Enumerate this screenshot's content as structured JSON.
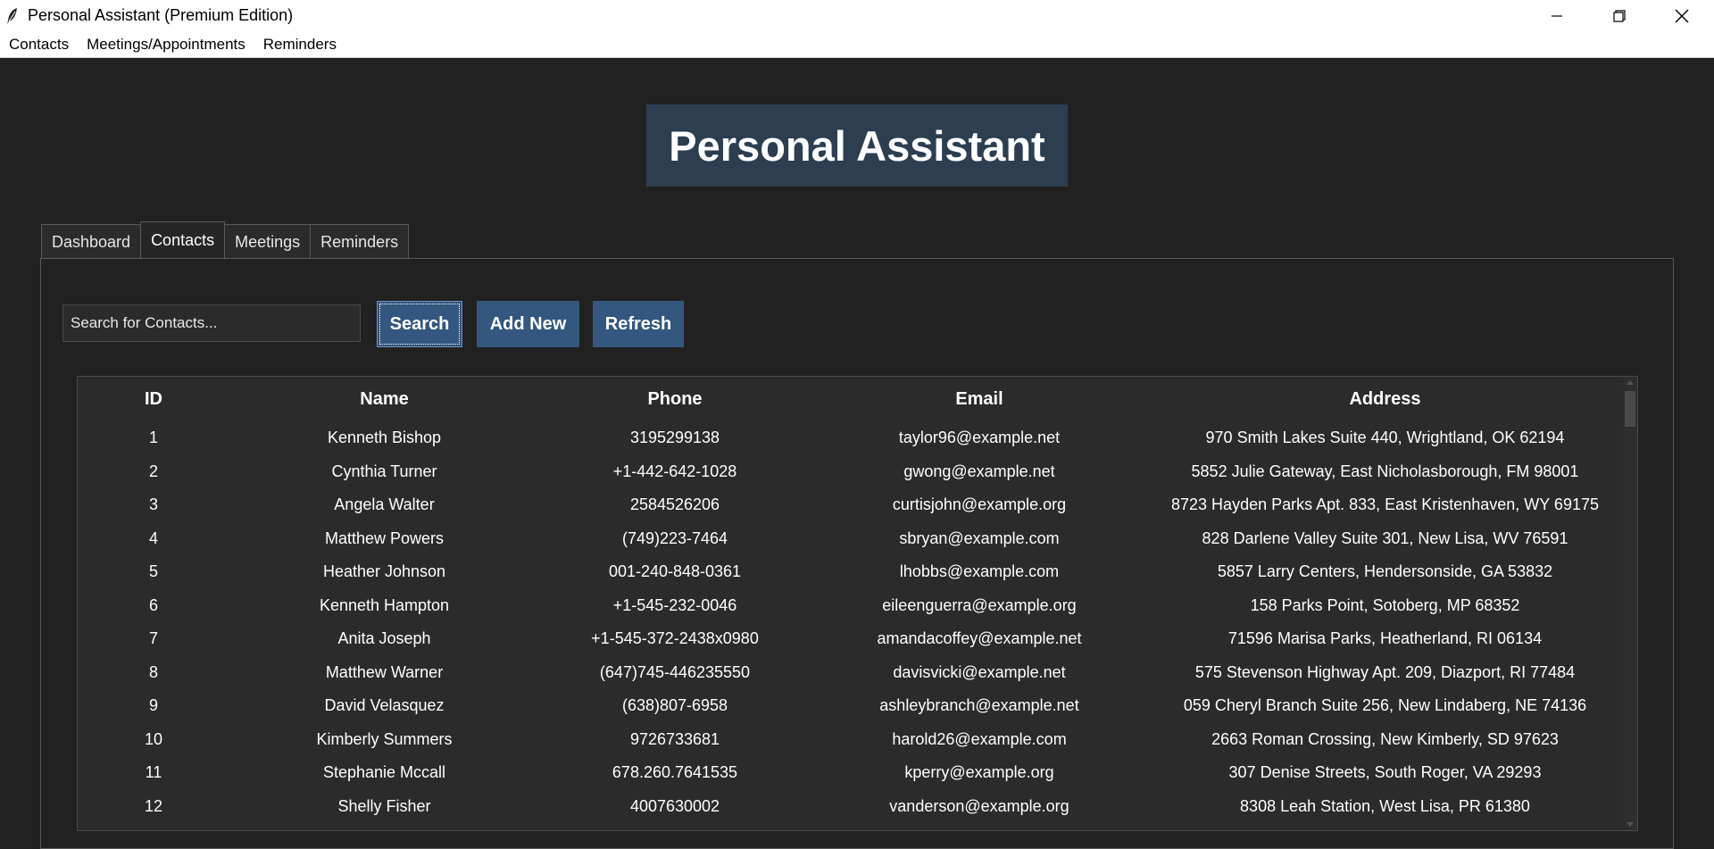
{
  "window": {
    "title": "Personal Assistant (Premium Edition)"
  },
  "menu": [
    "Contacts",
    "Meetings/Appointments",
    "Reminders"
  ],
  "banner": {
    "title": "Personal Assistant"
  },
  "tabs": [
    "Dashboard",
    "Contacts",
    "Meetings",
    "Reminders"
  ],
  "active_tab": "Contacts",
  "toolbar": {
    "search_placeholder": "Search for Contacts...",
    "search_label": "Search",
    "add_label": "Add New",
    "refresh_label": "Refresh"
  },
  "table": {
    "columns": [
      "ID",
      "Name",
      "Phone",
      "Email",
      "Address"
    ],
    "rows": [
      [
        "1",
        "Kenneth Bishop",
        "3195299138",
        "taylor96@example.net",
        "970 Smith Lakes Suite 440, Wrightland, OK 62194"
      ],
      [
        "2",
        "Cynthia Turner",
        "+1-442-642-1028",
        "gwong@example.net",
        "5852 Julie Gateway, East Nicholasborough, FM 98001"
      ],
      [
        "3",
        "Angela Walter",
        "2584526206",
        "curtisjohn@example.org",
        "8723 Hayden Parks Apt. 833, East Kristenhaven, WY 69175"
      ],
      [
        "4",
        "Matthew Powers",
        "(749)223-7464",
        "sbryan@example.com",
        "828 Darlene Valley Suite 301, New Lisa, WV 76591"
      ],
      [
        "5",
        "Heather Johnson",
        "001-240-848-0361",
        "lhobbs@example.com",
        "5857 Larry Centers, Hendersonside, GA 53832"
      ],
      [
        "6",
        "Kenneth Hampton",
        "+1-545-232-0046",
        "eileenguerra@example.org",
        "158 Parks Point, Sotoberg, MP 68352"
      ],
      [
        "7",
        "Anita Joseph",
        "+1-545-372-2438x0980",
        "amandacoffey@example.net",
        "71596 Marisa Parks, Heatherland, RI 06134"
      ],
      [
        "8",
        "Matthew Warner",
        "(647)745-446235550",
        "davisvicki@example.net",
        "575 Stevenson Highway Apt. 209, Diazport, RI 77484"
      ],
      [
        "9",
        "David Velasquez",
        "(638)807-6958",
        "ashleybranch@example.net",
        "059 Cheryl Branch Suite 256, New Lindaberg, NE 74136"
      ],
      [
        "10",
        "Kimberly Summers",
        "9726733681",
        "harold26@example.com",
        "2663 Roman Crossing, New Kimberly, SD 97623"
      ],
      [
        "11",
        "Stephanie Mccall",
        "678.260.7641535",
        "kperry@example.org",
        "307 Denise Streets, South Roger, VA 29293"
      ],
      [
        "12",
        "Shelly Fisher",
        "4007630002",
        "vanderson@example.org",
        "8308 Leah Station, West Lisa, PR 61380"
      ]
    ]
  },
  "colors": {
    "background": "#212121",
    "banner": "#2c3e50",
    "button": "#34577f",
    "table_bg": "#2b2b2b"
  },
  "icons": {
    "app": "feather-icon",
    "minimize": "minimize-icon",
    "restore": "restore-icon",
    "close": "close-icon"
  }
}
